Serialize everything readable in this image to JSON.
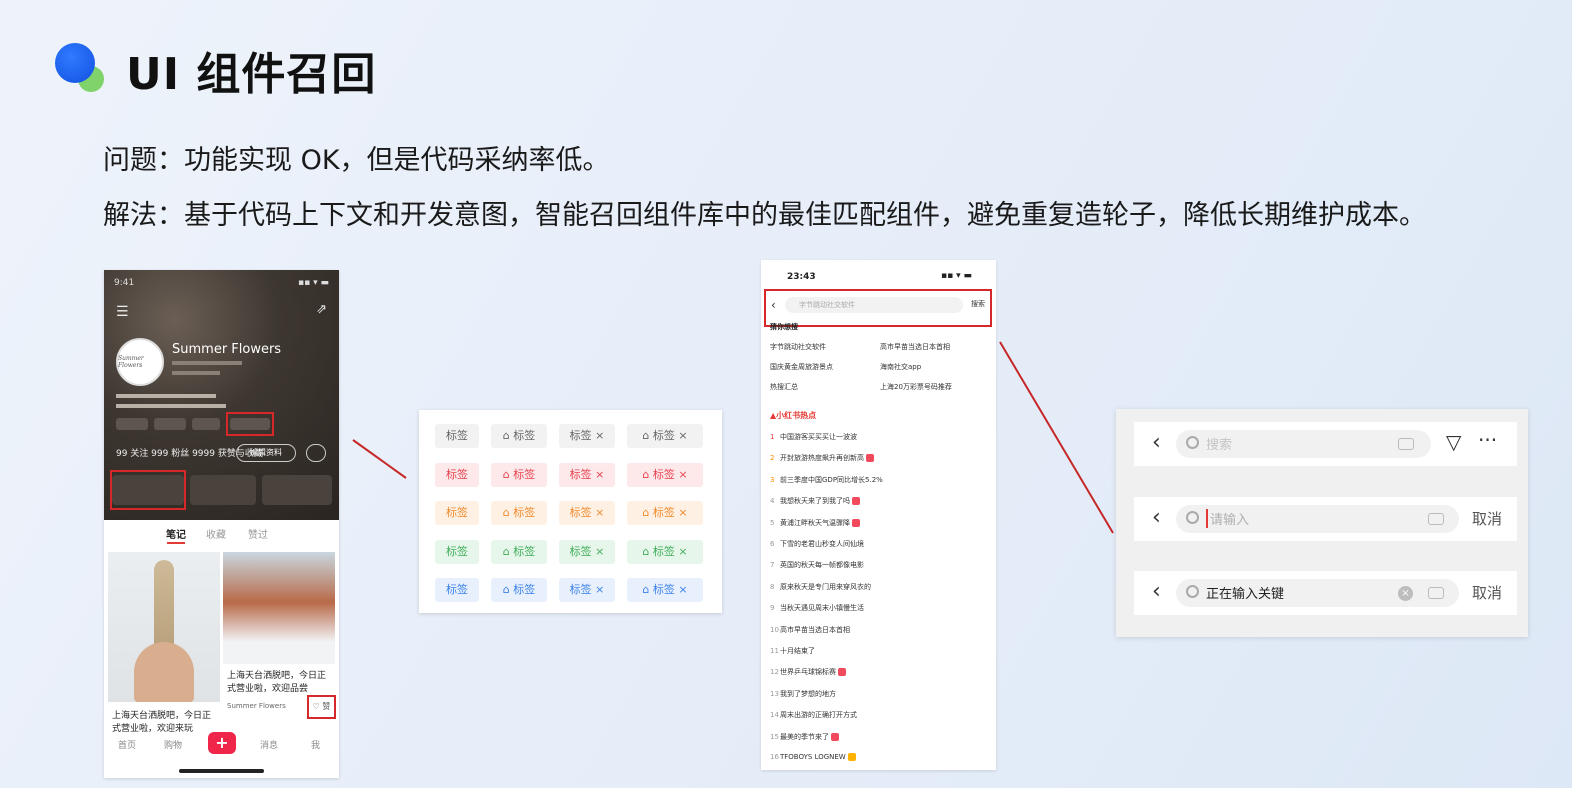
{
  "title": "UI 组件召回",
  "problem": "问题：功能实现 OK，但是代码采纳率低。",
  "solution": "解法：基于代码上下文和开发意图，智能召回组件库中的最佳匹配组件，避免重复造轮子，降低长期维护成本。",
  "profile_phone": {
    "time": "9:41",
    "name": "Summer Flowers",
    "avatar_text": "Summer Flowers",
    "edit_button": "编辑资料",
    "stats": "99 关注   999 粉丝   9999 获赞与收藏",
    "tabs": [
      "笔记",
      "收藏",
      "赞过"
    ],
    "caption_left": "上海天台洒脱吧，今日正式营业啦，欢迎来玩",
    "caption_right": "上海天台洒脱吧，今日正式营业啦，欢迎品尝",
    "author": "Summer Flowers",
    "like_label": "赞",
    "nav": [
      "首页",
      "购物",
      "消息",
      "我"
    ]
  },
  "tag_panel": {
    "rows": [
      {
        "color": "#666666",
        "bg": "#f2f2f2",
        "labels": [
          "标签",
          "⌂ 标签",
          "标签 ×",
          "⌂ 标签 ×"
        ]
      },
      {
        "color": "#e8414f",
        "bg": "#fde9ea",
        "labels": [
          "标签",
          "⌂ 标签",
          "标签 ×",
          "⌂ 标签 ×"
        ]
      },
      {
        "color": "#f08a2c",
        "bg": "#fef1e4",
        "labels": [
          "标签",
          "⌂ 标签",
          "标签 ×",
          "⌂ 标签 ×"
        ]
      },
      {
        "color": "#3fae5b",
        "bg": "#e7f6ea",
        "labels": [
          "标签",
          "⌂ 标签",
          "标签 ×",
          "⌂ 标签 ×"
        ]
      },
      {
        "color": "#3b82e8",
        "bg": "#e8f0fd",
        "labels": [
          "标签",
          "⌂ 标签",
          "标签 ×",
          "⌂ 标签 ×"
        ]
      }
    ]
  },
  "search_phone": {
    "time": "23:43",
    "placeholder": "字节跳动社交软件",
    "cancel": "搜索",
    "history_title": "猜你想搜",
    "suggestions": [
      [
        "字节跳动社交软件",
        "高市早苗当选日本首相"
      ],
      [
        "国庆黄金周旅游景点",
        "海南社交app"
      ],
      [
        "热搜汇总",
        "上海20万彩票号码推荐"
      ]
    ],
    "hot_title": "小红书热点",
    "hot_list": [
      "中国游客买买买让一波波",
      "开封旅游热度飙升再创新高",
      "前三季度中国GDP同比增长5.2%",
      "我想秋天来了到我了吗",
      "黄浦江畔秋天气温骤降",
      "下雪的老君山秒变人间仙境",
      "英国的秋天每一帧都像电影",
      "原来秋天是专门用来穿风衣的",
      "当秋天遇见周末小镇慢生活",
      "高市早苗当选日本首相",
      "十月结束了",
      "世界乒乓球锦标赛",
      "我到了梦想的地方",
      "周末出游的正确打开方式",
      "最美的季节来了",
      "TFOBOYS LOGNEW"
    ]
  },
  "search_panel": {
    "bar1_placeholder": "搜索",
    "bar2_placeholder": "请输入",
    "bar2_action": "取消",
    "bar3_text": "正在输入关键",
    "bar3_action": "取消",
    "more": "···",
    "filter": "▽"
  }
}
